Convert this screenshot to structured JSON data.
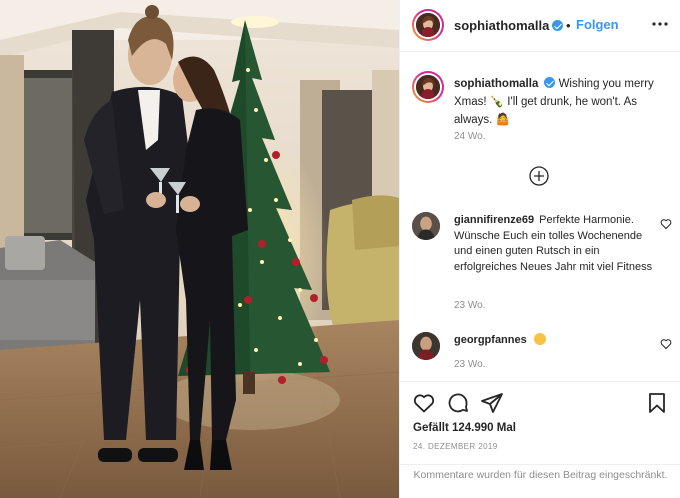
{
  "post": {
    "username": "sophiathomalla",
    "follow_label": "Folgen",
    "separator": "•",
    "more_icon": "more-horizontal-icon"
  },
  "caption": {
    "username": "sophiathomalla",
    "text": "Wishing you merry Xmas! 🍾 I'll get drunk, he won't. As always. 🤷",
    "time": "24 Wo."
  },
  "comments": [
    {
      "username": "giannifirenze69",
      "text": "Perfekte Harmonie. Wünsche Euch ein tolles Wochenende und einen guten Rutsch in ein erfolgreiches Neues Jahr mit viel Fitness",
      "time": "23 Wo."
    },
    {
      "username": "georgpfannes",
      "text": "",
      "time": "23 Wo."
    }
  ],
  "actions": {
    "likes": "Gefällt 124.990 Mal",
    "date": "24. DEZEMBER 2019",
    "restricted": "Kommentare wurden für diesen Beitrag eingeschränkt."
  },
  "colors": {
    "accent": "#3897f0",
    "text": "#262626",
    "muted": "#8e8e8e",
    "border": "#efefef"
  }
}
